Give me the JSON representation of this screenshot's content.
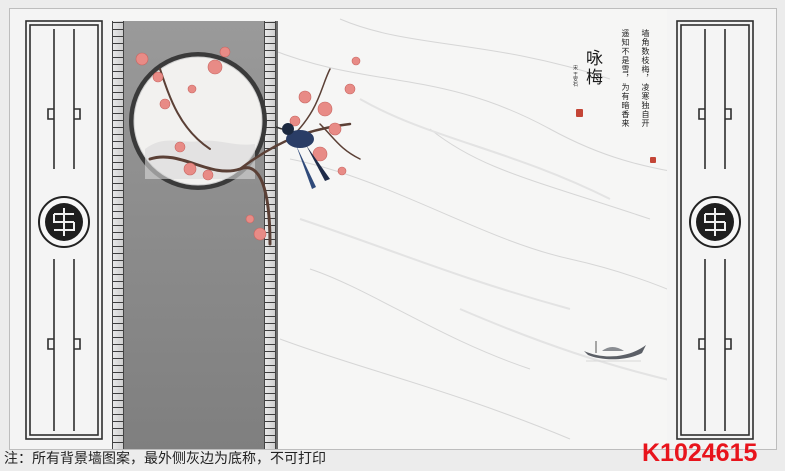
{
  "poem": {
    "title": "咏梅",
    "author": "宋 王安石",
    "lines": [
      "墙角数枝梅，凌寒独自开",
      "遥知不是雪，为有暗香来"
    ]
  },
  "footer": {
    "note": "注：所有背景墙图案，最外侧灰边为底称，不可打印",
    "product_code": "K1024615"
  },
  "colors": {
    "blossom": "#e88b86",
    "seal": "#c44536",
    "code": "#e8141c",
    "strip": "#8e8e8e"
  }
}
